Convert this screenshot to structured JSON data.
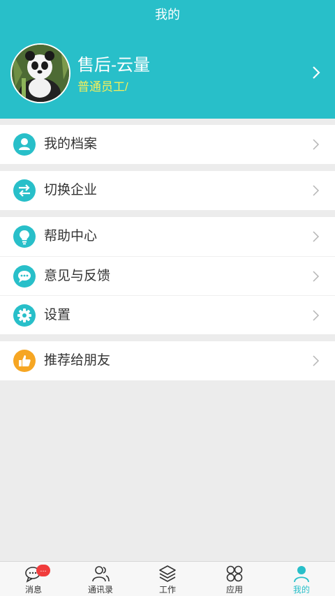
{
  "header": {
    "title": "我的"
  },
  "profile": {
    "name": "售后-云量",
    "role": "普通员工/",
    "avatar_icon": "panda-avatar"
  },
  "menu": {
    "groups": [
      [
        {
          "label": "我的档案",
          "icon": "person-icon"
        }
      ],
      [
        {
          "label": "切换企业",
          "icon": "swap-icon"
        }
      ],
      [
        {
          "label": "帮助中心",
          "icon": "lightbulb-icon"
        },
        {
          "label": "意见与反馈",
          "icon": "chat-bubble-icon"
        },
        {
          "label": "设置",
          "icon": "gear-icon"
        }
      ],
      [
        {
          "label": "推荐给朋友",
          "icon": "thumbs-up-icon"
        }
      ]
    ]
  },
  "tabbar": {
    "tabs": [
      {
        "label": "消息",
        "icon": "message-icon",
        "badge": "..."
      },
      {
        "label": "通讯录",
        "icon": "contacts-icon"
      },
      {
        "label": "工作",
        "icon": "layers-icon"
      },
      {
        "label": "应用",
        "icon": "apps-icon"
      },
      {
        "label": "我的",
        "icon": "me-icon",
        "active": true
      }
    ]
  },
  "colors": {
    "primary": "#28bfc9",
    "role_text": "#f5ef5a",
    "accent_orange": "#f6a623",
    "badge": "#f03c3c"
  }
}
